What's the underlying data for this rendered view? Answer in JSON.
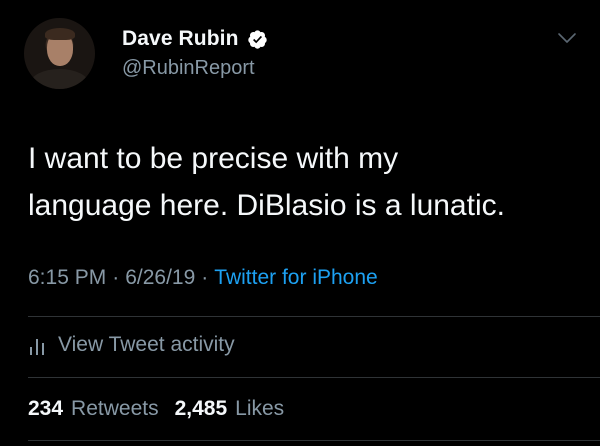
{
  "author": {
    "name": "Dave Rubin",
    "handle": "@RubinReport",
    "verified": true
  },
  "tweet": {
    "text_line1": "I want to be precise with my",
    "text_line2": "language here. DiBlasio is a lunatic.",
    "time": "6:15 PM",
    "date": "6/26/19",
    "separator": "·",
    "source": "Twitter for iPhone"
  },
  "activity": {
    "label": "View Tweet activity"
  },
  "stats": {
    "retweets_count": "234",
    "retweets_label": "Retweets",
    "likes_count": "2,485",
    "likes_label": "Likes"
  },
  "colors": {
    "background": "#000000",
    "primary_text": "#f5f8fa",
    "secondary_text": "#8899a6",
    "link": "#1da1f2",
    "verified_badge": "#ffffff"
  },
  "icons": {
    "verified": "verified-badge-icon",
    "menu": "chevron-down-icon",
    "activity": "bar-chart-icon"
  }
}
